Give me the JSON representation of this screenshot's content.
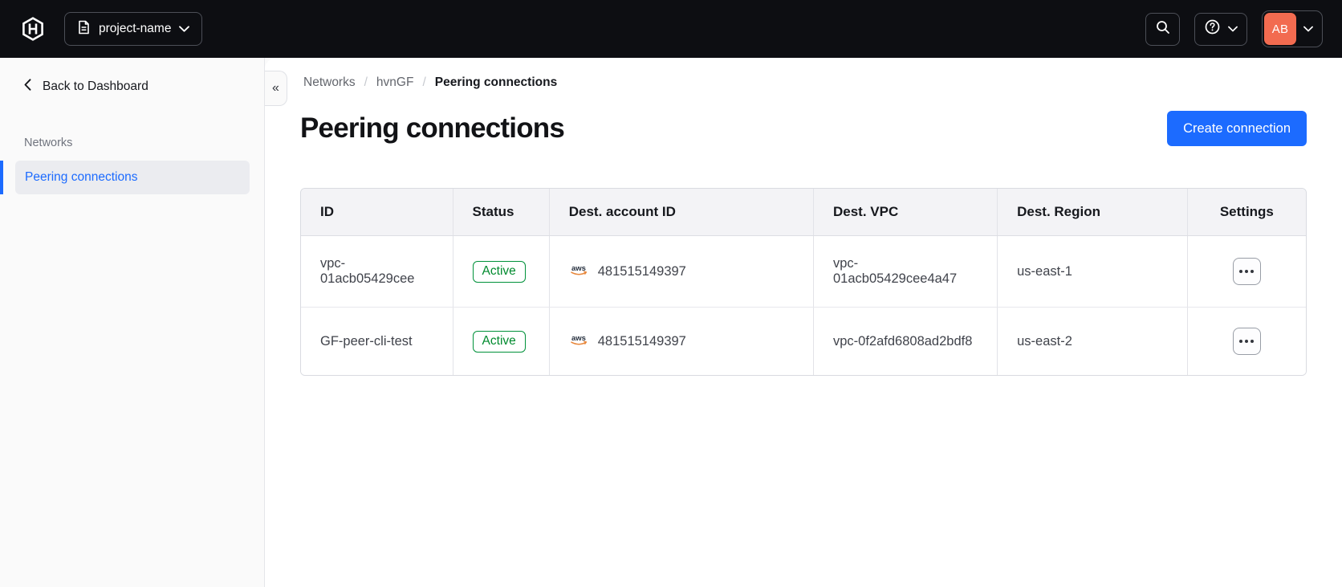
{
  "topbar": {
    "project_switcher": {
      "label": "project-name"
    },
    "account": {
      "initials": "AB"
    }
  },
  "sidebar": {
    "back_link": "Back to Dashboard",
    "section_label": "Networks",
    "items": [
      {
        "label": "Peering connections",
        "active": true
      }
    ],
    "collapse_glyph": "«"
  },
  "breadcrumb": {
    "items": [
      "Networks",
      "hvnGF",
      "Peering connections"
    ],
    "separator": "/"
  },
  "page": {
    "title": "Peering connections",
    "create_button_label": "Create connection"
  },
  "table": {
    "columns": [
      "ID",
      "Status",
      "Dest. account ID",
      "Dest. VPC",
      "Dest. Region",
      "Settings"
    ],
    "rows": [
      {
        "id": "vpc-01acb05429cee",
        "status": "Active",
        "provider": "aws",
        "dest_account_id": "481515149397",
        "dest_vpc": "vpc-01acb05429cee4a47",
        "dest_region": "us-east-1"
      },
      {
        "id": "GF-peer-cli-test",
        "status": "Active",
        "provider": "aws",
        "dest_account_id": "481515149397",
        "dest_vpc": "vpc-0f2afd6808ad2bdf8",
        "dest_region": "us-east-2"
      }
    ]
  },
  "colors": {
    "topbar_bg": "#0d0e12",
    "accent_blue": "#1c6bff",
    "success_green": "#008a2e",
    "avatar_orange": "#f26b50"
  }
}
